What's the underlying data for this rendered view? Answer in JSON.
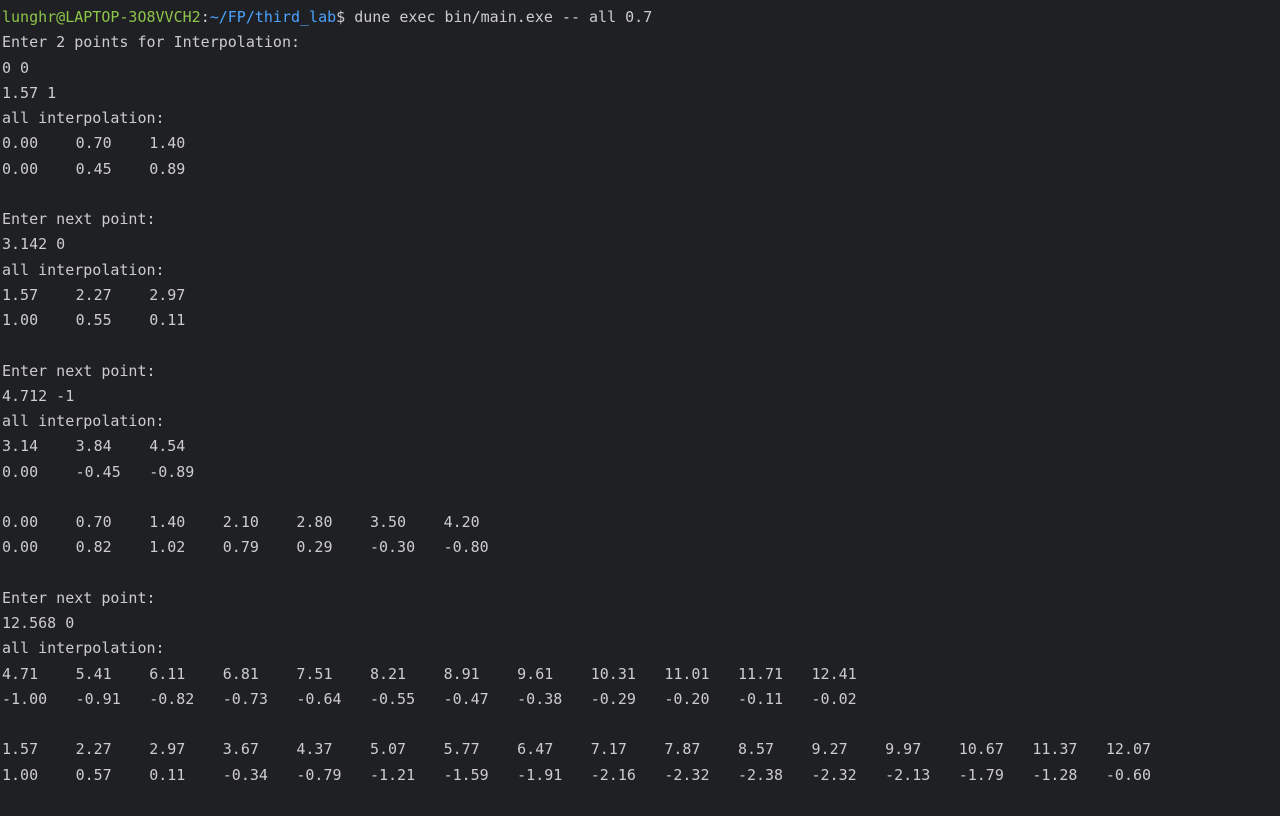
{
  "prompt": {
    "userhost": "lunghr@LAPTOP-3O8VVCH2",
    "colon": ":",
    "path": "~/FP/third_lab",
    "symbol": "$",
    "command": " dune exec bin/main.exe -- all 0.7"
  },
  "colors": {
    "background": "#1f2023",
    "text": "#cccccc",
    "userhost": "#8ec44a",
    "path": "#4aa3ff"
  },
  "lines": [
    {
      "text": "Enter 2 points for Interpolation:"
    },
    {
      "text": "0 0"
    },
    {
      "text": "1.57 1"
    },
    {
      "text": "all interpolation:"
    },
    {
      "cells": [
        "0.00",
        "0.70",
        "1.40"
      ]
    },
    {
      "cells": [
        "0.00",
        "0.45",
        "0.89"
      ]
    },
    {
      "text": ""
    },
    {
      "text": "Enter next point:"
    },
    {
      "text": "3.142 0"
    },
    {
      "text": "all interpolation:"
    },
    {
      "cells": [
        "1.57",
        "2.27",
        "2.97"
      ]
    },
    {
      "cells": [
        "1.00",
        "0.55",
        "0.11"
      ]
    },
    {
      "text": ""
    },
    {
      "text": "Enter next point:"
    },
    {
      "text": "4.712 -1"
    },
    {
      "text": "all interpolation:"
    },
    {
      "cells": [
        "3.14",
        "3.84",
        "4.54"
      ]
    },
    {
      "cells": [
        "0.00",
        "-0.45",
        "-0.89"
      ]
    },
    {
      "text": ""
    },
    {
      "cells": [
        "0.00",
        "0.70",
        "1.40",
        "2.10",
        "2.80",
        "3.50",
        "4.20"
      ]
    },
    {
      "cells": [
        "0.00",
        "0.82",
        "1.02",
        "0.79",
        "0.29",
        "-0.30",
        "-0.80"
      ]
    },
    {
      "text": ""
    },
    {
      "text": "Enter next point:"
    },
    {
      "text": "12.568 0"
    },
    {
      "text": "all interpolation:"
    },
    {
      "cells": [
        "4.71",
        "5.41",
        "6.11",
        "6.81",
        "7.51",
        "8.21",
        "8.91",
        "9.61",
        "10.31",
        "11.01",
        "11.71",
        "12.41"
      ]
    },
    {
      "cells": [
        "-1.00",
        "-0.91",
        "-0.82",
        "-0.73",
        "-0.64",
        "-0.55",
        "-0.47",
        "-0.38",
        "-0.29",
        "-0.20",
        "-0.11",
        "-0.02"
      ]
    },
    {
      "text": ""
    },
    {
      "cells": [
        "1.57",
        "2.27",
        "2.97",
        "3.67",
        "4.37",
        "5.07",
        "5.77",
        "6.47",
        "7.17",
        "7.87",
        "8.57",
        "9.27",
        "9.97",
        "10.67",
        "11.37",
        "12.07"
      ]
    },
    {
      "cells": [
        "1.00",
        "0.57",
        "0.11",
        "-0.34",
        "-0.79",
        "-1.21",
        "-1.59",
        "-1.91",
        "-2.16",
        "-2.32",
        "-2.38",
        "-2.32",
        "-2.13",
        "-1.79",
        "-1.28",
        "-0.60"
      ]
    }
  ]
}
